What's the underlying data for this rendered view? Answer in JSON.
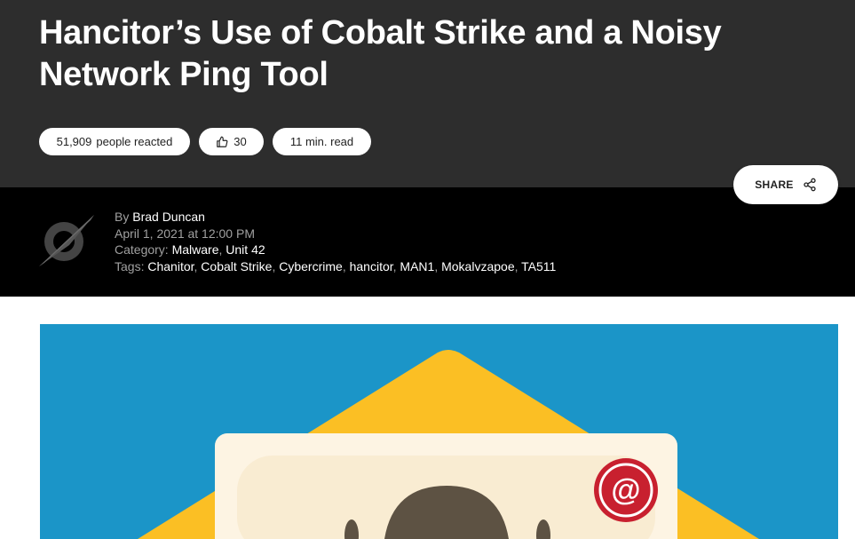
{
  "article": {
    "title": "Hancitor’s Use of Cobalt Strike and a Noisy Network Ping Tool",
    "reactions_count": "51,909",
    "reactions_label": "people reacted",
    "likes": "30",
    "read_time": "11 min. read",
    "share_label": "SHARE"
  },
  "meta": {
    "by_prefix": "By ",
    "author": "Brad Duncan",
    "date": "April 1, 2021 at 12:00 PM",
    "category_prefix": "Category: ",
    "categories": [
      "Malware",
      "Unit 42"
    ],
    "tags_prefix": "Tags: ",
    "tags": [
      "Chanitor",
      "Cobalt Strike",
      "Cybercrime",
      "hancitor",
      "MAN1",
      "Mokalvzapoe",
      "TA511"
    ]
  },
  "colors": {
    "hero_bg": "#2d2d2d",
    "meta_bg": "#000000",
    "image_bg": "#1b95c8",
    "envelope": "#fbbf24",
    "letter": "#fdf4e3",
    "at_badge": "#c8202f"
  },
  "icons": {
    "like": "thumbs-up-icon",
    "share": "share-icon",
    "at": "at-sign-icon",
    "author": "author-logo-icon"
  }
}
